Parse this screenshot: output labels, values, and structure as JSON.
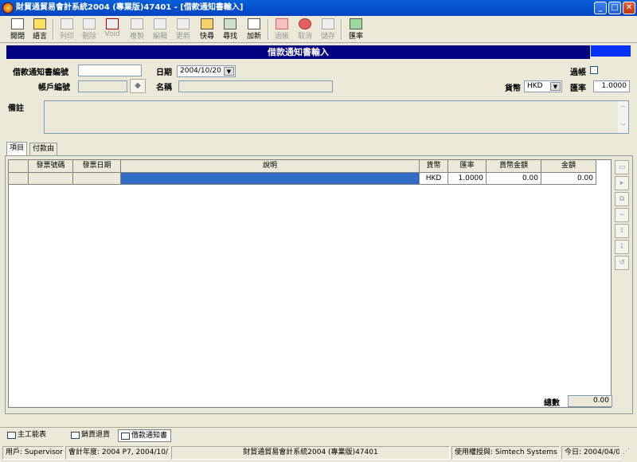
{
  "window": {
    "title": "財貿通貿易會計系統2004 (專業版)47401 - [借款通知書輸入]",
    "controls": {
      "minimize": "_",
      "maximize": "□",
      "close": "✕"
    }
  },
  "toolbar": [
    {
      "label": "開閉",
      "icon": "exit-icon",
      "enabled": true
    },
    {
      "label": "語言",
      "icon": "language-icon",
      "enabled": true
    },
    {
      "label": "列印",
      "icon": "print-icon",
      "enabled": false
    },
    {
      "label": "刪除",
      "icon": "delete-icon",
      "enabled": false
    },
    {
      "label": "Void",
      "icon": "void-icon",
      "enabled": false
    },
    {
      "label": "複製",
      "icon": "copy-icon",
      "enabled": false
    },
    {
      "label": "編輯",
      "icon": "edit-icon",
      "enabled": false
    },
    {
      "label": "更新",
      "icon": "refresh-icon",
      "enabled": false
    },
    {
      "label": "快尋",
      "icon": "quick-find-icon",
      "enabled": true
    },
    {
      "label": "尋找",
      "icon": "find-icon",
      "enabled": true
    },
    {
      "label": "加新",
      "icon": "new-icon",
      "enabled": true
    },
    {
      "label": "過帳",
      "icon": "post-icon",
      "enabled": false
    },
    {
      "label": "取消",
      "icon": "cancel-icon",
      "enabled": false
    },
    {
      "label": "儲存",
      "icon": "save-icon",
      "enabled": false
    },
    {
      "label": "匯率",
      "icon": "exchange-rate-icon",
      "enabled": true
    }
  ],
  "form": {
    "title": "借款通知書輸入",
    "fields": {
      "notice_no_label": "借款通知書編號",
      "notice_no_value": "",
      "date_label": "日期",
      "date_value": "2004/10/20",
      "posted_label": "過帳",
      "account_no_label": "帳戶編號",
      "account_no_value": "",
      "name_label": "名稱",
      "name_value": "",
      "currency_label": "貨幣",
      "currency_value": "HKD",
      "rate_label": "匯率",
      "rate_value": "1.0000",
      "remarks_label": "備註",
      "remarks_value": ""
    }
  },
  "tabs": [
    {
      "label": "項目",
      "active": true
    },
    {
      "label": "付款由",
      "active": false
    }
  ],
  "grid": {
    "columns": [
      "發票號碼",
      "發票日期",
      "說明",
      "貨幣",
      "匯率",
      "貨幣金額",
      "金額"
    ],
    "rows": [
      [
        "",
        "",
        "",
        "HKD",
        "1.0000",
        "0.00",
        "0.00"
      ]
    ]
  },
  "side_buttons": [
    "add-row-icon",
    "insert-row-icon",
    "copy-row-icon",
    "delete-row-icon",
    "move-up-icon",
    "move-down-icon",
    "refresh-row-icon"
  ],
  "total": {
    "label": "總數",
    "value": "0.00"
  },
  "window_tabs": [
    {
      "label": "主工能表",
      "active": false
    },
    {
      "label": "銷貨退貨",
      "active": false
    },
    {
      "label": "借款通知書",
      "active": true
    }
  ],
  "status": {
    "user": "用戶: Supervisor",
    "fiscal": "會計年度: 2004 P7, 2004/10/20",
    "app": "財貿通貿易會計系統2004 (專業版)47401",
    "license": "使用權授與: Simtech Systems Ltd.",
    "today": "今日: 2004/04/01"
  }
}
